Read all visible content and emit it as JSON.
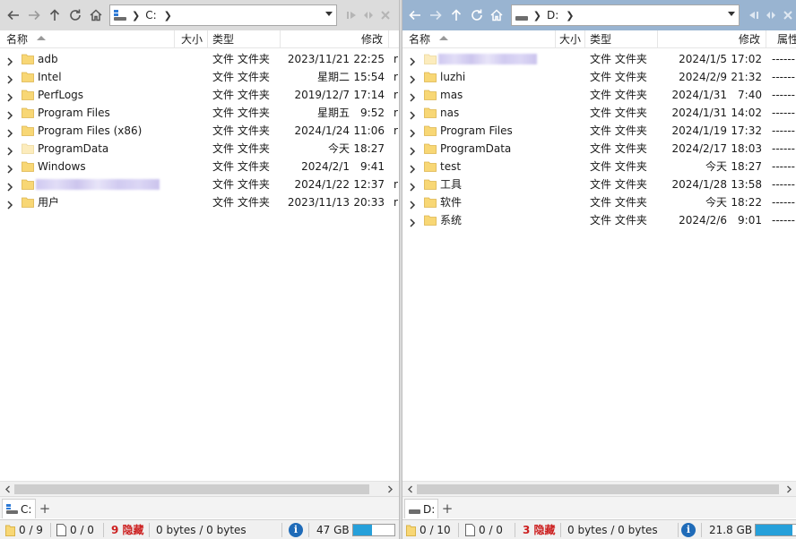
{
  "left_pane": {
    "path": "C:",
    "columns": {
      "name": "名称",
      "size": "大小",
      "type": "类型",
      "modified": "修改"
    },
    "rows": [
      {
        "name": "adb",
        "type": "文件 文件夹",
        "date": "2023/11/21",
        "time": "22:25",
        "extra": "r"
      },
      {
        "name": "Intel",
        "type": "文件 文件夹",
        "date": "星期二",
        "time": "15:54",
        "extra": "r"
      },
      {
        "name": "PerfLogs",
        "type": "文件 文件夹",
        "date": "2019/12/7",
        "time": "17:14",
        "extra": "r"
      },
      {
        "name": "Program Files",
        "type": "文件 文件夹",
        "date": "星期五",
        "time": "9:52",
        "extra": "r"
      },
      {
        "name": "Program Files (x86)",
        "type": "文件 文件夹",
        "date": "2024/1/24",
        "time": "11:06",
        "extra": "r"
      },
      {
        "name": "ProgramData",
        "type": "文件 文件夹",
        "date": "今天",
        "time": "18:27",
        "extra": ""
      },
      {
        "name": "Windows",
        "type": "文件 文件夹",
        "date": "2024/2/1",
        "time": "9:41",
        "extra": ""
      },
      {
        "name": "",
        "type": "文件 文件夹",
        "date": "2024/1/22",
        "time": "12:37",
        "extra": "r"
      },
      {
        "name": "用户",
        "type": "文件 文件夹",
        "date": "2023/11/13",
        "time": "20:33",
        "extra": "r"
      }
    ],
    "tab_label": "C:",
    "status": {
      "folders": "0 / 9",
      "files": "0 / 0",
      "hidden": "9 隐藏",
      "bytes": "0 bytes / 0 bytes",
      "free_space": "47 GB",
      "space_used_fraction": 0.45
    }
  },
  "right_pane": {
    "path": "D:",
    "columns": {
      "name": "名称",
      "size": "大小",
      "type": "类型",
      "modified": "修改",
      "attributes": "属性"
    },
    "rows": [
      {
        "name": "",
        "type": "文件 文件夹",
        "date": "2024/1/5",
        "time": "17:02",
        "attr": "------"
      },
      {
        "name": "luzhi",
        "type": "文件 文件夹",
        "date": "2024/2/9",
        "time": "21:32",
        "attr": "------"
      },
      {
        "name": "mas",
        "type": "文件 文件夹",
        "date": "2024/1/31",
        "time": "7:40",
        "attr": "------"
      },
      {
        "name": "nas",
        "type": "文件 文件夹",
        "date": "2024/1/31",
        "time": "14:02",
        "attr": "------"
      },
      {
        "name": "Program Files",
        "type": "文件 文件夹",
        "date": "2024/1/19",
        "time": "17:32",
        "attr": "------"
      },
      {
        "name": "ProgramData",
        "type": "文件 文件夹",
        "date": "2024/2/17",
        "time": "18:03",
        "attr": "------"
      },
      {
        "name": "test",
        "type": "文件 文件夹",
        "date": "今天",
        "time": "18:27",
        "attr": "------"
      },
      {
        "name": "工具",
        "type": "文件 文件夹",
        "date": "2024/1/28",
        "time": "13:58",
        "attr": "------"
      },
      {
        "name": "软件",
        "type": "文件 文件夹",
        "date": "今天",
        "time": "18:22",
        "attr": "------"
      },
      {
        "name": "系统",
        "type": "文件 文件夹",
        "date": "2024/2/6",
        "time": "9:01",
        "attr": "------"
      }
    ],
    "tab_label": "D:",
    "status": {
      "folders": "0 / 10",
      "files": "0 / 0",
      "hidden": "3 隐藏",
      "bytes": "0 bytes / 0 bytes",
      "free_space": "21.8 GB",
      "space_used_fraction": 0.85
    }
  },
  "colors": {
    "left_toolbar": "#dcdcdc",
    "right_toolbar": "#99b4d1",
    "folder_yellow": "#f8d775",
    "hidden_red": "#cc1f1f",
    "space_bar_blue": "#26a0da"
  },
  "icons": [
    "back-icon",
    "forward-icon",
    "up-icon",
    "refresh-icon",
    "home-icon",
    "drive-icon",
    "chevron-right-icon",
    "folder-icon",
    "info-icon",
    "file-icon"
  ]
}
